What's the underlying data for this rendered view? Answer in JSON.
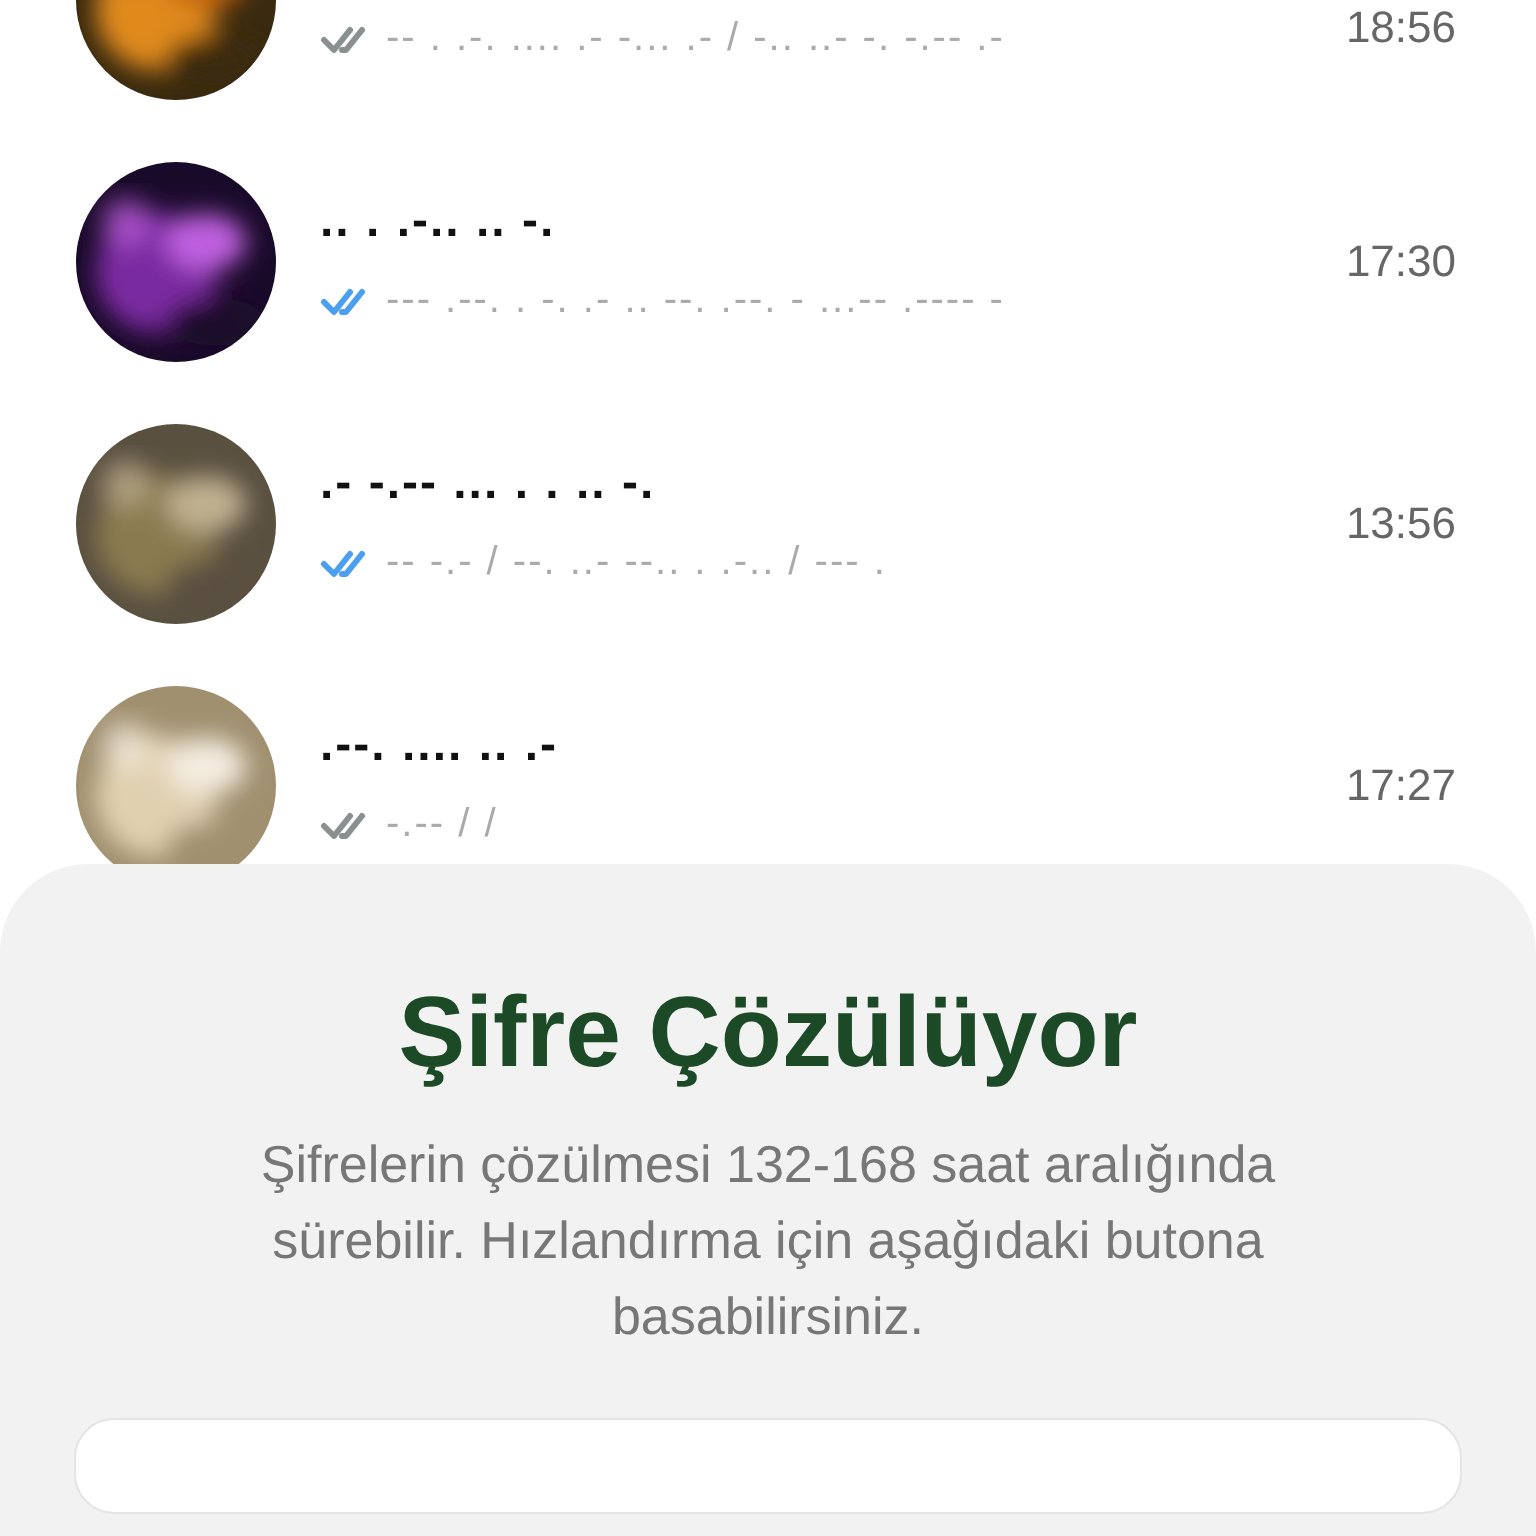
{
  "chats": [
    {
      "preview": "-- . .-. .... .- -... .- / -.. ..- -. -.-- .-",
      "time": "18:56",
      "read": false
    },
    {
      "title": ".. . .-.. .. -.",
      "preview": "--- .--. . -. .- .. --. .--. - ...-- .---- -",
      "time": "17:30",
      "read": true
    },
    {
      "title": ".- -.-- ... . . .. -.",
      "preview": "-- -.- / --. ..- --.. . .-.. / --- .",
      "time": "13:56",
      "read": true
    },
    {
      "title": ".--. .... .. .-",
      "preview": "-.-- / /",
      "time": "17:27",
      "read": false
    }
  ],
  "sheet": {
    "title": "Şifre Çözülüyor",
    "text": "Şifrelerin çözülmesi 132-168 saat aralığında sürebilir. Hızlandırma için aşağıdaki butona basabilirsiniz."
  }
}
